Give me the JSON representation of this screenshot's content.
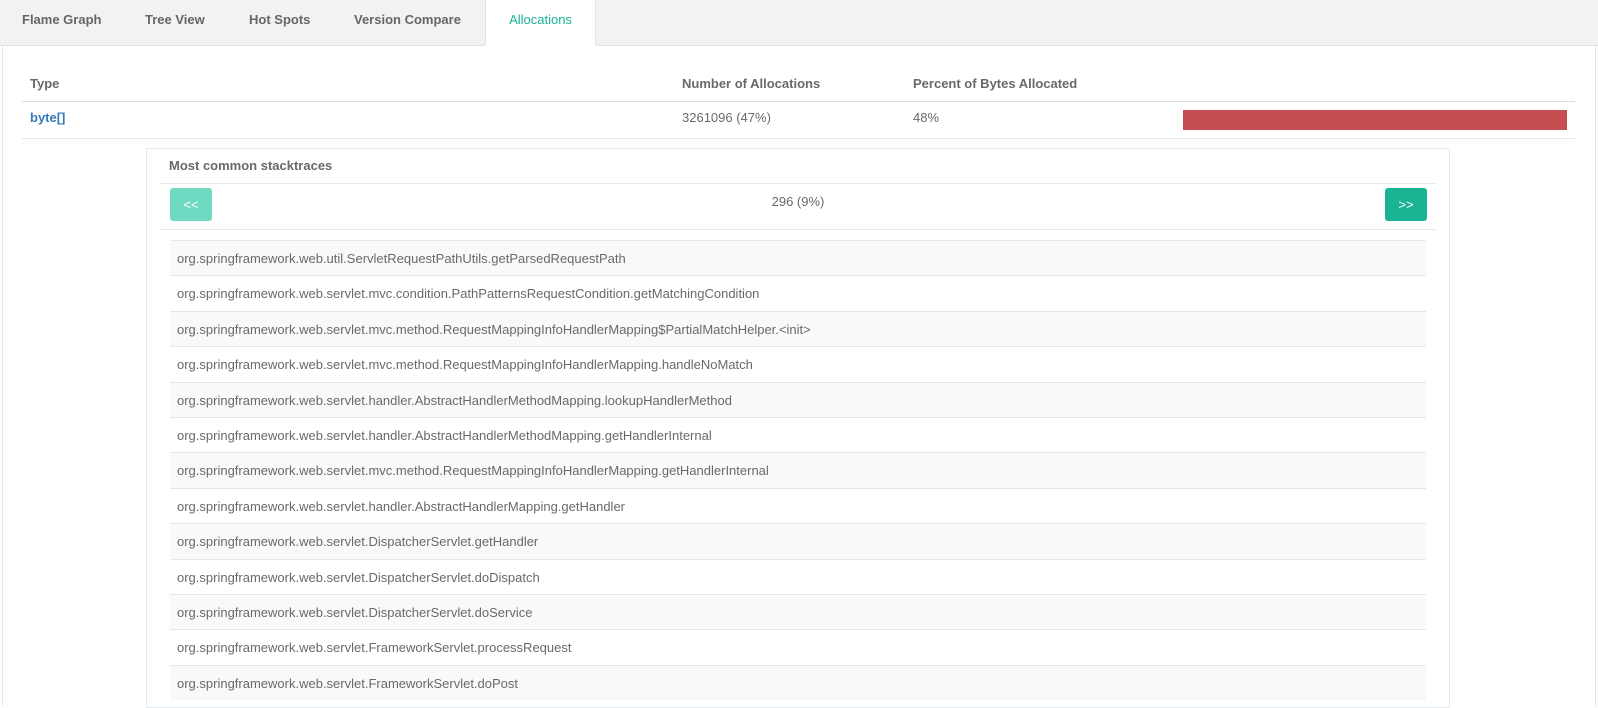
{
  "tabs": [
    {
      "label": "Flame Graph",
      "active": false
    },
    {
      "label": "Tree View",
      "active": false
    },
    {
      "label": "Hot Spots",
      "active": false
    },
    {
      "label": "Version Compare",
      "active": false
    },
    {
      "label": "Allocations",
      "active": true
    }
  ],
  "table": {
    "headers": {
      "type": "Type",
      "count": "Number of Allocations",
      "percent": "Percent of Bytes Allocated"
    },
    "row": {
      "type": "byte[]",
      "count": "3261096 (47%)",
      "percent": "48%",
      "bar_fraction": 1.0,
      "bar_color": "#c44e52"
    }
  },
  "stacktraces": {
    "title": "Most common stacktraces",
    "prev_label": "<<",
    "next_label": ">>",
    "page_info": "296 (9%)",
    "frames": [
      "org.springframework.web.util.ServletRequestPathUtils.getParsedRequestPath",
      "org.springframework.web.servlet.mvc.condition.PathPatternsRequestCondition.getMatchingCondition",
      "org.springframework.web.servlet.mvc.method.RequestMappingInfoHandlerMapping$PartialMatchHelper.<init>",
      "org.springframework.web.servlet.mvc.method.RequestMappingInfoHandlerMapping.handleNoMatch",
      "org.springframework.web.servlet.handler.AbstractHandlerMethodMapping.lookupHandlerMethod",
      "org.springframework.web.servlet.handler.AbstractHandlerMethodMapping.getHandlerInternal",
      "org.springframework.web.servlet.mvc.method.RequestMappingInfoHandlerMapping.getHandlerInternal",
      "org.springframework.web.servlet.handler.AbstractHandlerMapping.getHandler",
      "org.springframework.web.servlet.DispatcherServlet.getHandler",
      "org.springframework.web.servlet.DispatcherServlet.doDispatch",
      "org.springframework.web.servlet.DispatcherServlet.doService",
      "org.springframework.web.servlet.FrameworkServlet.processRequest",
      "org.springframework.web.servlet.FrameworkServlet.doPost"
    ]
  },
  "colors": {
    "accent": "#1ab394",
    "accent_light": "#6fd9c2",
    "link": "#337ab7"
  }
}
